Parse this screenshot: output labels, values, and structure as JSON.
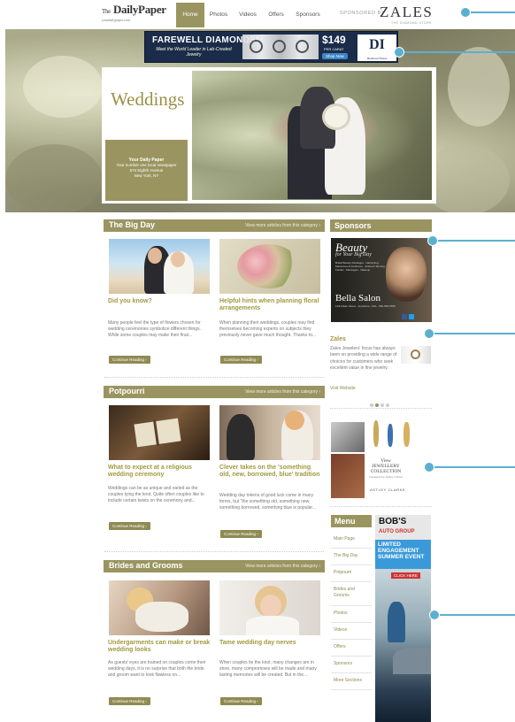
{
  "header": {
    "logo": "DailyPaper",
    "logo_prefix": "The",
    "logo_sub": "yourdailypaper.com",
    "nav": [
      "Home",
      "Photos",
      "Videos",
      "Offers",
      "Sponsors"
    ],
    "sponsored_by": "SPONSORED BY",
    "sponsor_logo": "ZALES",
    "sponsor_tagline": "THE DIAMOND STORE"
  },
  "banner": {
    "title": "FAREWELL DIAMONDS!",
    "subtitle": "Meet the World Leader in Lab-Created Jewelry",
    "price": "$149",
    "price_note": "PER CARAT",
    "cta": "Shop Now",
    "brand": "DI",
    "brand_sub": "Diamond Nexus"
  },
  "feature": {
    "title": "Weddings",
    "box_title": "Your Daily Paper",
    "box_line1": "Your number one local newspaper",
    "box_line2": "574 Eighth Avenue",
    "box_line3": "New York, NY"
  },
  "sections": [
    {
      "title": "The Big Day",
      "more": "View more articles from this category ›",
      "articles": [
        {
          "title": "Did you know?",
          "excerpt": "Many people feel the type of flowers chosen for wedding ceremonies symbolize different things. While some couples may make their final...",
          "button": "Continue Reading ›"
        },
        {
          "title": "Helpful hints when planning floral arrangements",
          "excerpt": "When planning their weddings, couples may find themselves becoming experts on subjects they previously never gave much thought. Thanks to...",
          "button": "Continue Reading ›"
        }
      ]
    },
    {
      "title": "Potpourri",
      "more": "View more articles from this category ›",
      "articles": [
        {
          "title": "What to expect at a religious wedding ceremony",
          "excerpt": "Weddings can be as unique and varied as the couples tying the knot. Quite often couples like to include certain twists on the ceremony and...",
          "button": "Continue Reading ›"
        },
        {
          "title": "Clever takes on the 'something old, new, borrowed, blue' tradition",
          "excerpt": "Wedding day tokens of good luck come in many forms, but \"the something old, something new, something borrowed, something blue is popular...",
          "button": "Continue Reading ›"
        }
      ]
    },
    {
      "title": "Brides and Grooms",
      "more": "View more articles from this category ›",
      "articles": [
        {
          "title": "Undergarments can make or break wedding looks",
          "excerpt": "As guests' eyes are trained on couples come their wedding days, it is no surprise that both the bride and groom want to look flawless on...",
          "button": "Continue Reading ›"
        },
        {
          "title": "Tame wedding day nerves",
          "excerpt": "When couples tie the knot, many changes are in store, many compromises will be made and many lasting memories will be created. But in the...",
          "button": "Continue Reading ›"
        }
      ]
    }
  ],
  "sidebar": {
    "sponsors_title": "Sponsors",
    "beauty_ad": {
      "headline": "Beauty",
      "subline": "for Your Big Day",
      "details": "Bridal Beauty Packages · Hairstyling · Manicures & Pedicures · Airbrush Tanning · Facials · Massages · Makeup",
      "salon": "Bella Salon",
      "address": "1234 Main Street · Anywhere, USA · 555-555-5555"
    },
    "zales": {
      "name": "Zales",
      "text": "Zales Jewelers' focus has always been on providing a wide range of choices for customers who seek excellent value in fine jewelry.",
      "link": "Visit Website"
    },
    "carousel_active": 1,
    "jewelry_ad": {
      "line1": "View",
      "line2": "JEWELLERY COLLECTION",
      "line3": "Designed by Astley Clarke",
      "logo": "ASTLEY CLARKE"
    },
    "menu_title": "Menu",
    "menu": [
      "Main Page",
      "The Big Day",
      "Potpourri",
      "Brides and Grooms",
      "Photos",
      "Videos",
      "Offers",
      "Sponsors",
      "More Sections"
    ],
    "bobs_ad": {
      "brand": "BOB'S",
      "brand_sub": "AUTO GROUP",
      "promo": "LIMITED ENGAGEMENT SUMMER EVENT",
      "cta": "CLICK HERE"
    }
  },
  "colors": {
    "accent": "#9a9560",
    "title_gold": "#a2993f",
    "pointer": "#5bb0d0"
  }
}
